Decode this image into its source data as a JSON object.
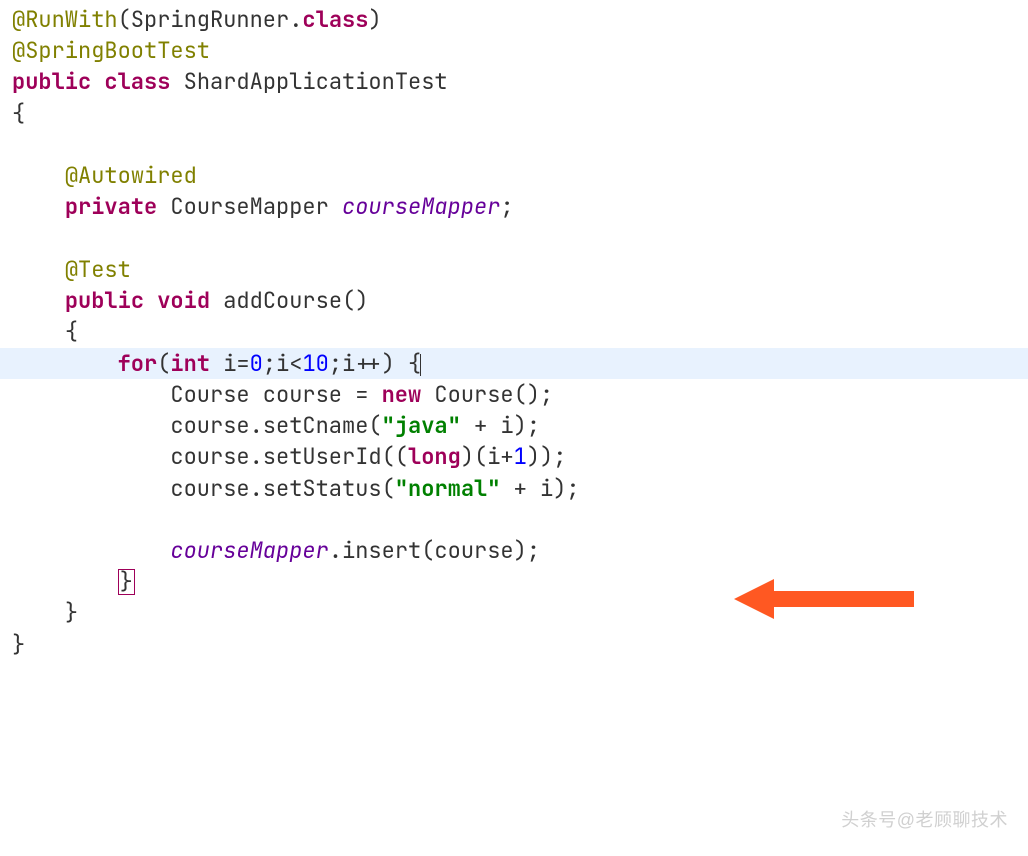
{
  "code": {
    "l1_ann": "@RunWith",
    "l1_p1": "(SpringRunner.",
    "l1_kw": "class",
    "l1_p2": ")",
    "l2_ann": "@SpringBootTest",
    "l3_kw1": "public",
    "l3_kw2": "class",
    "l3_name": "ShardApplicationTest",
    "l4": "{",
    "l5_ann": "@Autowired",
    "l6_kw": "private",
    "l6_type": "CourseMapper",
    "l6_field": "courseMapper",
    "l6_semi": ";",
    "l7_ann": "@Test",
    "l8_kw1": "public",
    "l8_kw2": "void",
    "l8_name": "addCourse",
    "l8_paren": "()",
    "l9": "{",
    "l10_kw1": "for",
    "l10_p1": "(",
    "l10_kw2": "int",
    "l10_rest": " i=",
    "l10_n0": "0",
    "l10_mid": ";i<",
    "l10_n10": "10",
    "l10_end": ";i++) {",
    "l11_p1": "Course course = ",
    "l11_kw": "new",
    "l11_p2": " Course();",
    "l12_p1": "course.setCname(",
    "l12_str": "\"java\"",
    "l12_p2": " + i);",
    "l13_p1": "course.setUserId((",
    "l13_kw": "long",
    "l13_p2": ")(i+",
    "l13_n1": "1",
    "l13_p3": "));",
    "l14_p1": "course.setStatus(",
    "l14_str": "\"normal\"",
    "l14_p2": " + i);",
    "l15_p1": "courseMapper",
    "l15_p2": ".insert(course);",
    "l16": "}",
    "l17": "}",
    "l18": "}"
  },
  "watermark": "头条号@老顾聊技术",
  "colors": {
    "keyword": "#9e0059",
    "annotation": "#808000",
    "string": "#008000",
    "field": "#660099",
    "highlight_bg": "#e8f2fe",
    "arrow": "#ff5822"
  }
}
